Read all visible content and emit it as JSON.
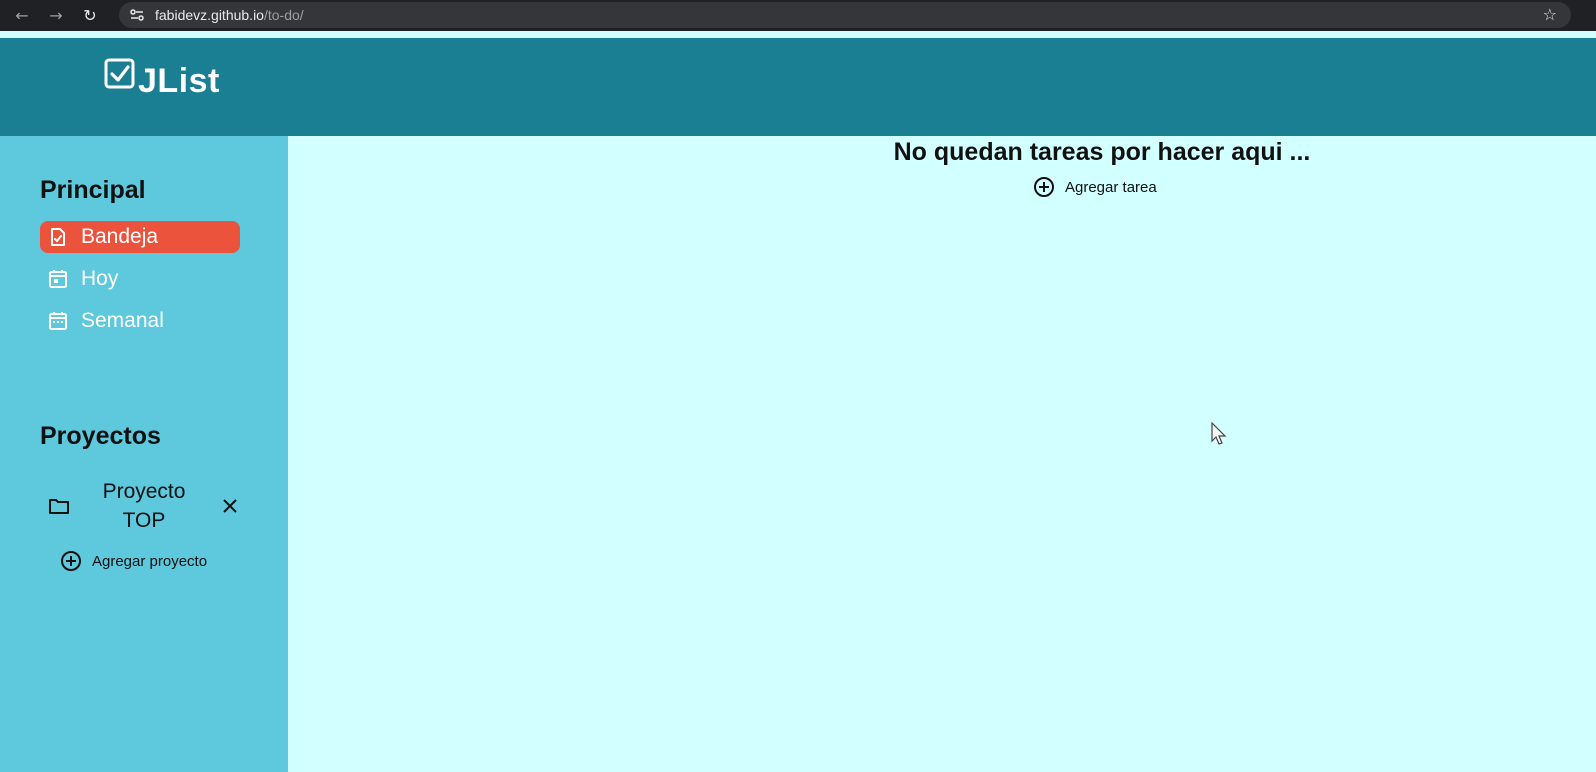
{
  "browser": {
    "url_host": "fabidevz.github.io",
    "url_path": "/to-do/",
    "icons": [
      "back-icon",
      "forward-icon",
      "reload-icon",
      "site-info-icon",
      "bookmark-star-icon"
    ]
  },
  "header": {
    "title": "JList"
  },
  "sidebar": {
    "main_section": "Principal",
    "items": [
      {
        "label": "Bandeja",
        "icon": "inbox-doc-icon",
        "active": true
      },
      {
        "label": "Hoy",
        "icon": "calendar-today-icon"
      },
      {
        "label": "Semanal",
        "icon": "calendar-week-icon"
      }
    ],
    "projects_section": "Proyectos",
    "projects": [
      {
        "label_line1": "Proyecto",
        "label_line2": "TOP"
      }
    ],
    "add_project_label": "Agregar proyecto"
  },
  "main": {
    "empty_message": "No quedan tareas por hacer aqui ...",
    "add_task_label": "Agregar tarea"
  },
  "colors": {
    "header_bg": "#1a7f92",
    "sidebar_bg": "#5ec8dd",
    "main_bg": "#d2ffff",
    "active_item": "#ec533c"
  }
}
